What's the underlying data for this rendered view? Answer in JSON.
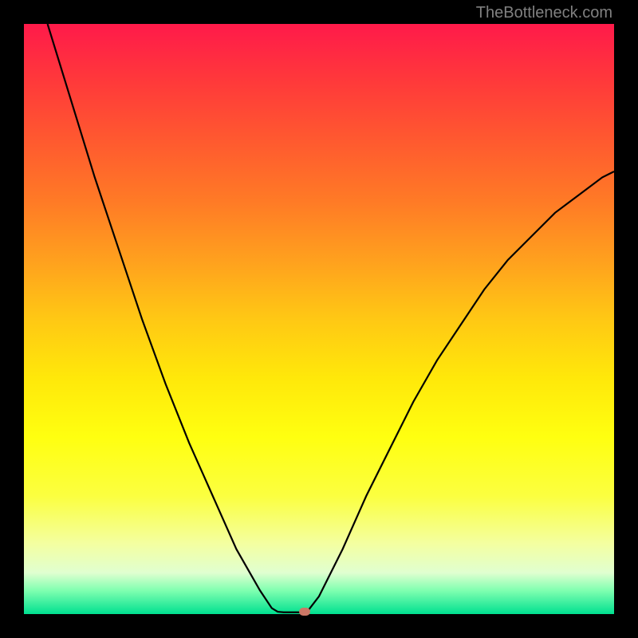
{
  "watermark": "TheBottleneck.com",
  "chart_data": {
    "type": "line",
    "title": "",
    "xlabel": "",
    "ylabel": "",
    "xlim": [
      0,
      100
    ],
    "ylim": [
      0,
      100
    ],
    "series": [
      {
        "name": "bottleneck-curve",
        "points": [
          {
            "x": 4,
            "y": 100
          },
          {
            "x": 8,
            "y": 87
          },
          {
            "x": 12,
            "y": 74
          },
          {
            "x": 16,
            "y": 62
          },
          {
            "x": 20,
            "y": 50
          },
          {
            "x": 24,
            "y": 39
          },
          {
            "x": 28,
            "y": 29
          },
          {
            "x": 32,
            "y": 20
          },
          {
            "x": 36,
            "y": 11
          },
          {
            "x": 40,
            "y": 4
          },
          {
            "x": 42,
            "y": 1
          },
          {
            "x": 43,
            "y": 0.4
          },
          {
            "x": 44,
            "y": 0.3
          },
          {
            "x": 45,
            "y": 0.3
          },
          {
            "x": 46,
            "y": 0.3
          },
          {
            "x": 47,
            "y": 0.3
          },
          {
            "x": 48,
            "y": 0.4
          },
          {
            "x": 50,
            "y": 3
          },
          {
            "x": 54,
            "y": 11
          },
          {
            "x": 58,
            "y": 20
          },
          {
            "x": 62,
            "y": 28
          },
          {
            "x": 66,
            "y": 36
          },
          {
            "x": 70,
            "y": 43
          },
          {
            "x": 74,
            "y": 49
          },
          {
            "x": 78,
            "y": 55
          },
          {
            "x": 82,
            "y": 60
          },
          {
            "x": 86,
            "y": 64
          },
          {
            "x": 90,
            "y": 68
          },
          {
            "x": 94,
            "y": 71
          },
          {
            "x": 98,
            "y": 74
          },
          {
            "x": 100,
            "y": 75
          }
        ]
      }
    ],
    "marker": {
      "x": 47.5,
      "y": 0.4,
      "color": "#cc7766"
    },
    "gradient_colors": {
      "top": "#ff1a4a",
      "mid": "#ffea00",
      "bottom": "#00e090"
    }
  }
}
